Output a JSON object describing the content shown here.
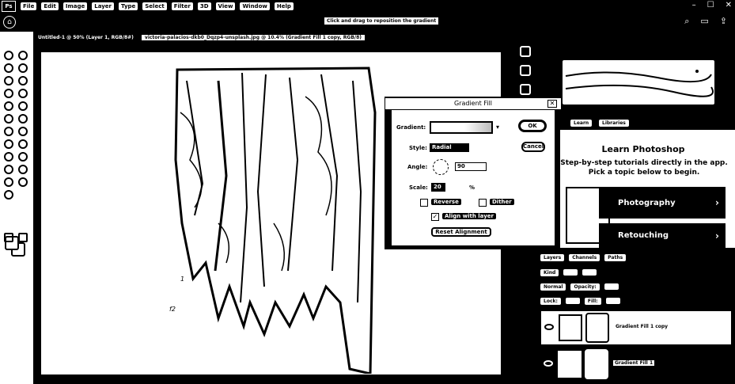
{
  "app": {
    "logo": "Ps"
  },
  "menu": [
    "File",
    "Edit",
    "Image",
    "Layer",
    "Type",
    "Select",
    "Filter",
    "3D",
    "View",
    "Window",
    "Help"
  ],
  "window_controls": [
    "–",
    "☐",
    "✕"
  ],
  "options_bar": {
    "hint": "Click and drag to reposition the gradient",
    "home_icon": "home-icon"
  },
  "tabs": [
    {
      "label": "Untitled-1 @ 50% (Layer 1, RGB/8#)",
      "active": false
    },
    {
      "label": "victoria-palacios-dkb0_Dqzp4-unsplash.jpg @ 10.4% (Gradient Fill 1 copy, RGB/8)",
      "active": true
    }
  ],
  "canvas": {
    "label_1": "1",
    "label_2": "f2"
  },
  "learn_panel": {
    "tab_1": "Learn",
    "tab_2": "Libraries",
    "title": "Learn Photoshop",
    "description": "Step-by-step tutorials directly in the app. Pick a topic below to begin.",
    "cards": [
      "Photography",
      "Retouching"
    ]
  },
  "layers_panel": {
    "tabs": [
      "Layers",
      "Channels",
      "Paths"
    ],
    "kind_label": "Kind",
    "opacity_label": "Opacity:",
    "fill_label": "Fill:",
    "lock_label": "Lock:",
    "layers": [
      {
        "name": "Gradient Fill 1 copy",
        "selected": true
      },
      {
        "name": "Gradient Fill 1",
        "selected": false
      }
    ]
  },
  "gradient_dialog": {
    "title": "Gradient Fill",
    "gradient_label": "Gradient:",
    "style_label": "Style:",
    "style_value": "Radial",
    "angle_label": "Angle:",
    "angle_value": "90",
    "scale_label": "Scale:",
    "scale_value": "20",
    "scale_unit": "%",
    "reverse_label": "Reverse",
    "dither_label": "Dither",
    "align_label": "Align with layer",
    "reset_label": "Reset Alignment",
    "ok_label": "OK",
    "cancel_label": "Cancel",
    "reverse_checked": false,
    "dither_checked": false,
    "align_checked": true
  }
}
